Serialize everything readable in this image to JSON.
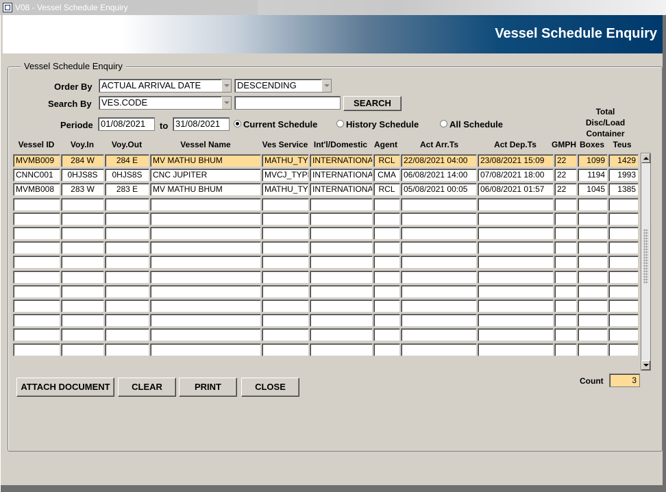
{
  "window": {
    "title": "V08 - Vessel Schedule Enquiry"
  },
  "banner": {
    "title": "Vessel Schedule Enquiry"
  },
  "group": {
    "legend": "Vessel Schedule Enquiry"
  },
  "form": {
    "order_by_label": "Order By",
    "order_by_value": "ACTUAL ARRIVAL DATE",
    "order_dir_value": "DESCENDING",
    "search_by_label": "Search By",
    "search_by_value": "VES.CODE",
    "search_text": "",
    "search_button": "SEARCH",
    "periode_label": "Periode",
    "date_from": "01/08/2021",
    "to_label": "to",
    "date_to": "31/08/2021",
    "schedule_options": [
      {
        "label": "Current Schedule",
        "selected": true
      },
      {
        "label": "History Schedule",
        "selected": false
      },
      {
        "label": "All Schedule",
        "selected": false
      }
    ]
  },
  "table": {
    "columns": [
      "Vessel ID",
      "Voy.In",
      "Voy.Out",
      "Vessel Name",
      "Ves Service",
      "Int'l/Domestic",
      "Agent",
      "Act Arr.Ts",
      "Act Dep.Ts",
      "GMPH",
      "Boxes",
      "Teus"
    ],
    "total_header": "Total\nDisc/Load\nContainer",
    "rows": [
      [
        "MVMB009",
        "284 W",
        "284 E",
        "MV MATHU BHUM",
        "MATHU_TYPE",
        "INTERNATIONAL",
        "RCL",
        "22/08/2021 04:00",
        "23/08/2021 15:09",
        "22",
        "1099",
        "1429"
      ],
      [
        "CNNC001",
        "0HJS8S",
        "0HJS8S",
        "CNC JUPITER",
        "MVCJ_TYPE",
        "INTERNATIONAL",
        "CMA",
        "06/08/2021 14:00",
        "07/08/2021 18:00",
        "22",
        "1194",
        "1993"
      ],
      [
        "MVMB008",
        "283 W",
        "283 E",
        "MV MATHU BHUM",
        "MATHU_TYPE",
        "INTERNATIONAL",
        "RCL",
        "05/08/2021 00:05",
        "06/08/2021 01:57",
        "22",
        "1045",
        "1385"
      ]
    ],
    "empty_rows": 11,
    "selected_row": 0
  },
  "buttons": {
    "attach": "ATTACH DOCUMENT",
    "clear": "CLEAR",
    "print": "PRINT",
    "close": "CLOSE"
  },
  "count": {
    "label": "Count",
    "value": "3"
  },
  "colors": {
    "selected_row": "#fedc98",
    "banner_dark": "#003a6c"
  }
}
